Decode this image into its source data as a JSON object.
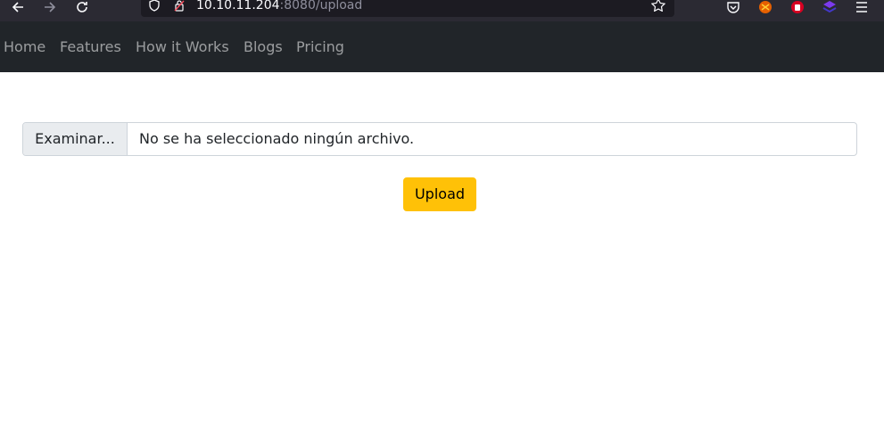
{
  "browser": {
    "url_host": "10.10.11.204",
    "url_rest": ":8080/upload"
  },
  "navbar": {
    "links": [
      "Home",
      "Features",
      "How it Works",
      "Blogs",
      "Pricing"
    ]
  },
  "upload_form": {
    "browse_label": "Examinar...",
    "file_status": "No se ha seleccionado ningún archivo.",
    "submit_label": "Upload"
  },
  "colors": {
    "navbar_bg": "#212529",
    "upload_button": "#ffc107",
    "browser_toolbar": "#2b2a33"
  },
  "icons": {
    "toolbar": [
      "back-arrow-icon",
      "forward-arrow-icon",
      "reload-icon",
      "shield-icon",
      "insecure-lock-icon",
      "bookmark-star-icon",
      "pocket-icon",
      "extension-icon-1",
      "extension-icon-2",
      "extension-icon-3",
      "menu-icon"
    ]
  }
}
